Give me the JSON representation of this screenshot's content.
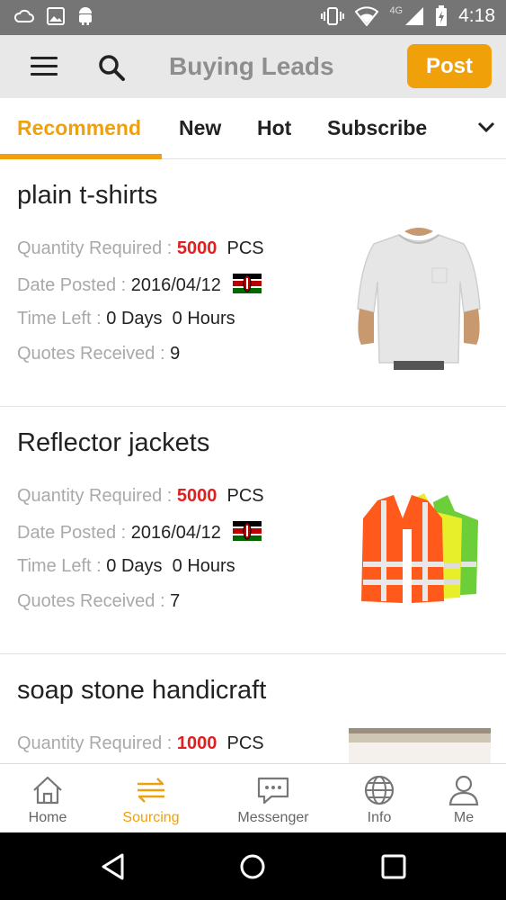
{
  "status_bar": {
    "time": "4:18",
    "network": "4G",
    "icons": [
      "cloud-icon",
      "image-icon",
      "android-icon",
      "vibrate-icon",
      "wifi-icon",
      "signal-icon",
      "battery-charging-icon"
    ]
  },
  "app_bar": {
    "title": "Buying Leads",
    "post_label": "Post",
    "menu_icon": "menu-icon",
    "search_icon": "search-icon"
  },
  "tabs": [
    {
      "label": "Recommend",
      "active": true
    },
    {
      "label": "New",
      "active": false
    },
    {
      "label": "Hot",
      "active": false
    },
    {
      "label": "Subscribe",
      "active": false
    }
  ],
  "labels": {
    "quantity": "Quantity Required : ",
    "date": "Date Posted : ",
    "time_left": "Time Left : ",
    "quotes": "Quotes Received : "
  },
  "leads": [
    {
      "title": "plain t-shirts",
      "quantity": "5000",
      "unit": "PCS",
      "date_posted": "2016/04/12",
      "country_flag": "kenya-flag",
      "time_left": "0 Days  0 Hours",
      "quotes_received": "9",
      "image": "white-tshirt"
    },
    {
      "title": "Reflector jackets",
      "quantity": "5000",
      "unit": "PCS",
      "date_posted": "2016/04/12",
      "country_flag": "kenya-flag",
      "time_left": "0 Days  0 Hours",
      "quotes_received": "7",
      "image": "reflector-vests"
    },
    {
      "title": "soap stone handicraft",
      "quantity": "1000",
      "unit": "PCS",
      "image": "soapstone-photo"
    }
  ],
  "bottom_nav": [
    {
      "label": "Home",
      "icon": "home-icon",
      "active": false
    },
    {
      "label": "Sourcing",
      "icon": "sourcing-icon",
      "active": true
    },
    {
      "label": "Messenger",
      "icon": "messenger-icon",
      "active": false
    },
    {
      "label": "Info",
      "icon": "globe-icon",
      "active": false
    },
    {
      "label": "Me",
      "icon": "person-icon",
      "active": false
    }
  ],
  "colors": {
    "accent": "#f0a10a",
    "quantity_red": "#e02020",
    "label_gray": "#a9a9a9",
    "status_bar": "#757575",
    "app_bar": "#e8e8e8"
  }
}
